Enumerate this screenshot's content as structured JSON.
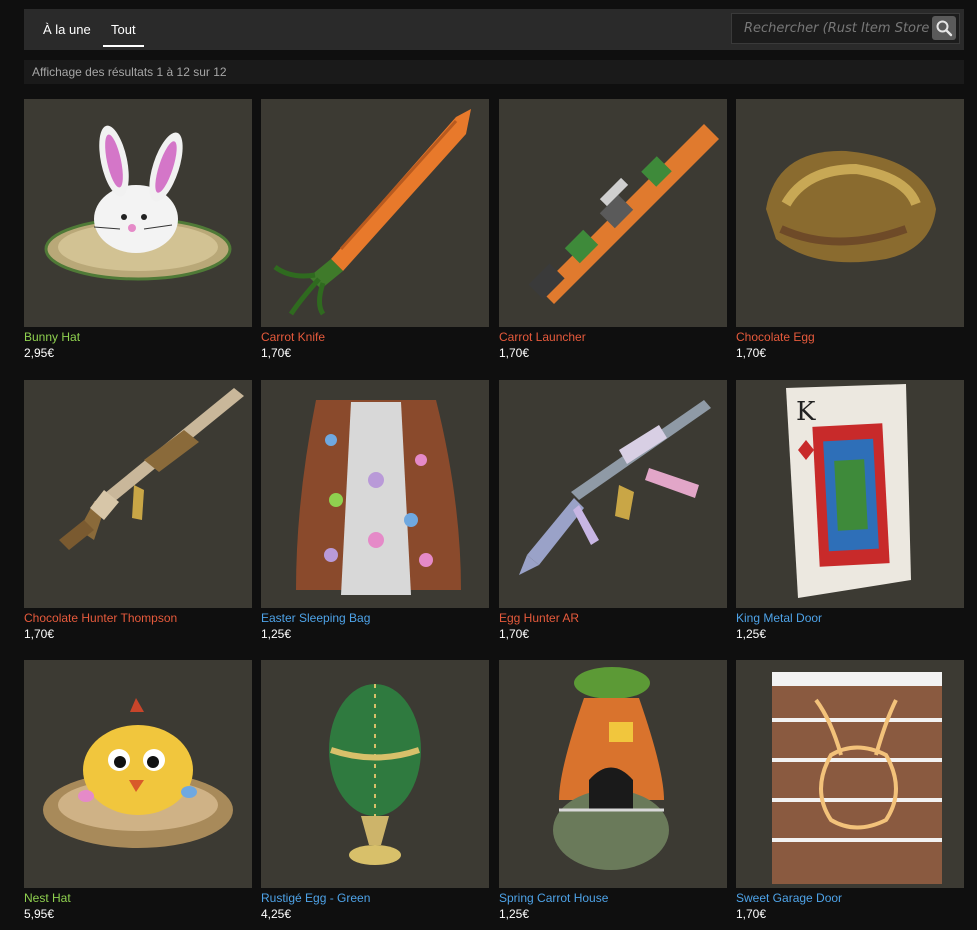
{
  "tabs": [
    {
      "label": "À la une"
    },
    {
      "label": "Tout"
    }
  ],
  "search": {
    "placeholder": "Rechercher (Rust Item Store"
  },
  "results_text": "Affichage des résultats 1 à 12 sur 12",
  "rarity_colors": {
    "green": "#8fd14f",
    "red": "#e65a3c",
    "blue": "#4ea3e8"
  },
  "items": [
    {
      "name": "Bunny Hat",
      "price": "2,95€",
      "color": "#8fd14f",
      "icon": "bunny-hat-icon"
    },
    {
      "name": "Carrot Knife",
      "price": "1,70€",
      "color": "#e65a3c",
      "icon": "carrot-knife-icon"
    },
    {
      "name": "Carrot Launcher",
      "price": "1,70€",
      "color": "#e65a3c",
      "icon": "carrot-launcher-icon"
    },
    {
      "name": "Chocolate Egg",
      "price": "1,70€",
      "color": "#e65a3c",
      "icon": "chocolate-egg-icon"
    },
    {
      "name": "Chocolate Hunter Thompson",
      "price": "1,70€",
      "color": "#e65a3c",
      "icon": "thompson-gun-icon"
    },
    {
      "name": "Easter Sleeping Bag",
      "price": "1,25€",
      "color": "#4ea3e8",
      "icon": "sleeping-bag-icon"
    },
    {
      "name": "Egg Hunter AR",
      "price": "1,70€",
      "color": "#e65a3c",
      "icon": "assault-rifle-icon"
    },
    {
      "name": "King Metal Door",
      "price": "1,25€",
      "color": "#4ea3e8",
      "icon": "king-card-door-icon"
    },
    {
      "name": "Nest Hat",
      "price": "5,95€",
      "color": "#8fd14f",
      "icon": "chick-nest-hat-icon"
    },
    {
      "name": "Rustigé Egg - Green",
      "price": "4,25€",
      "color": "#4ea3e8",
      "icon": "faberge-egg-icon"
    },
    {
      "name": "Spring Carrot House",
      "price": "1,25€",
      "color": "#4ea3e8",
      "icon": "carrot-house-icon"
    },
    {
      "name": "Sweet Garage Door",
      "price": "1,70€",
      "color": "#4ea3e8",
      "icon": "garage-door-icon"
    }
  ]
}
